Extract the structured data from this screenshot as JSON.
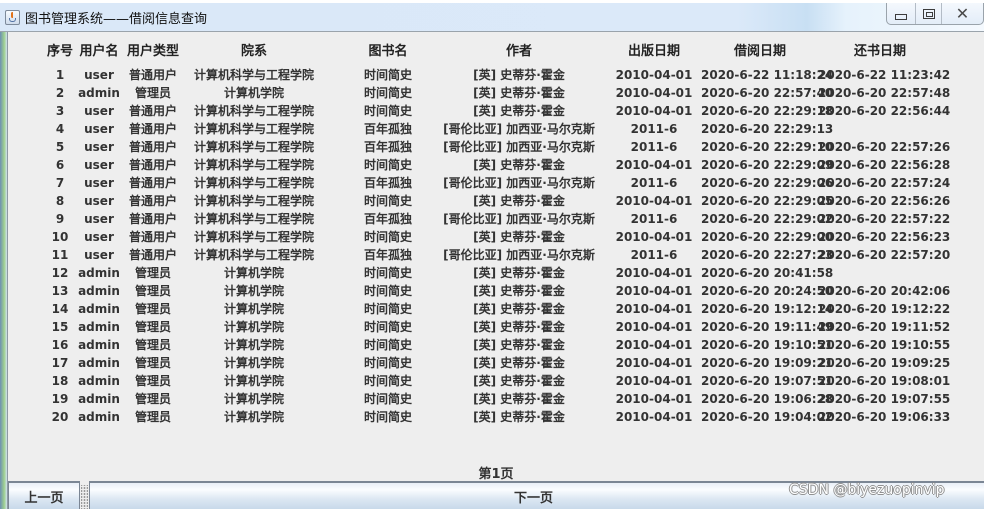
{
  "window": {
    "title": "图书管理系统——借阅信息查询",
    "icon": "java-cup-icon",
    "controls": {
      "minimize": "minimize-icon",
      "maximize": "maximize-icon",
      "close_glyph": "✕"
    }
  },
  "table": {
    "columns": [
      "序号",
      "用户名",
      "用户类型",
      "院系",
      "图书名",
      "作者",
      "出版日期",
      "借阅日期",
      "还书日期"
    ],
    "rows": [
      [
        "1",
        "user",
        "普通用户",
        "计算机科学与工程学院",
        "时间简史",
        "[英] 史蒂芬·霍金",
        "2010-04-01",
        "2020-6-22 11:18:24",
        "2020-6-22 11:23:42"
      ],
      [
        "2",
        "admin",
        "管理员",
        "计算机学院",
        "时间简史",
        "[英] 史蒂芬·霍金",
        "2010-04-01",
        "2020-6-20 22:57:40",
        "2020-6-20 22:57:48"
      ],
      [
        "3",
        "user",
        "普通用户",
        "计算机科学与工程学院",
        "时间简史",
        "[英] 史蒂芬·霍金",
        "2010-04-01",
        "2020-6-20 22:29:18",
        "2020-6-20 22:56:44"
      ],
      [
        "4",
        "user",
        "普通用户",
        "计算机科学与工程学院",
        "百年孤独",
        "[哥伦比亚] 加西亚·马尔克斯",
        "2011-6",
        "2020-6-20 22:29:13",
        ""
      ],
      [
        "5",
        "user",
        "普通用户",
        "计算机科学与工程学院",
        "百年孤独",
        "[哥伦比亚] 加西亚·马尔克斯",
        "2011-6",
        "2020-6-20 22:29:10",
        "2020-6-20 22:57:26"
      ],
      [
        "6",
        "user",
        "普通用户",
        "计算机科学与工程学院",
        "时间简史",
        "[英] 史蒂芬·霍金",
        "2010-04-01",
        "2020-6-20 22:29:09",
        "2020-6-20 22:56:28"
      ],
      [
        "7",
        "user",
        "普通用户",
        "计算机科学与工程学院",
        "百年孤独",
        "[哥伦比亚] 加西亚·马尔克斯",
        "2011-6",
        "2020-6-20 22:29:06",
        "2020-6-20 22:57:24"
      ],
      [
        "8",
        "user",
        "普通用户",
        "计算机科学与工程学院",
        "时间简史",
        "[英] 史蒂芬·霍金",
        "2010-04-01",
        "2020-6-20 22:29:05",
        "2020-6-20 22:56:26"
      ],
      [
        "9",
        "user",
        "普通用户",
        "计算机科学与工程学院",
        "百年孤独",
        "[哥伦比亚] 加西亚·马尔克斯",
        "2011-6",
        "2020-6-20 22:29:02",
        "2020-6-20 22:57:22"
      ],
      [
        "10",
        "user",
        "普通用户",
        "计算机科学与工程学院",
        "时间简史",
        "[英] 史蒂芬·霍金",
        "2010-04-01",
        "2020-6-20 22:29:00",
        "2020-6-20 22:56:23"
      ],
      [
        "11",
        "user",
        "普通用户",
        "计算机科学与工程学院",
        "百年孤独",
        "[哥伦比亚] 加西亚·马尔克斯",
        "2011-6",
        "2020-6-20 22:27:23",
        "2020-6-20 22:57:20"
      ],
      [
        "12",
        "admin",
        "管理员",
        "计算机学院",
        "时间简史",
        "[英] 史蒂芬·霍金",
        "2010-04-01",
        "2020-6-20 20:41:58",
        ""
      ],
      [
        "13",
        "admin",
        "管理员",
        "计算机学院",
        "时间简史",
        "[英] 史蒂芬·霍金",
        "2010-04-01",
        "2020-6-20 20:24:50",
        "2020-6-20 20:42:06"
      ],
      [
        "14",
        "admin",
        "管理员",
        "计算机学院",
        "时间简史",
        "[英] 史蒂芬·霍金",
        "2010-04-01",
        "2020-6-20 19:12:14",
        "2020-6-20 19:12:22"
      ],
      [
        "15",
        "admin",
        "管理员",
        "计算机学院",
        "时间简史",
        "[英] 史蒂芬·霍金",
        "2010-04-01",
        "2020-6-20 19:11:49",
        "2020-6-20 19:11:52"
      ],
      [
        "16",
        "admin",
        "管理员",
        "计算机学院",
        "时间简史",
        "[英] 史蒂芬·霍金",
        "2010-04-01",
        "2020-6-20 19:10:51",
        "2020-6-20 19:10:55"
      ],
      [
        "17",
        "admin",
        "管理员",
        "计算机学院",
        "时间简史",
        "[英] 史蒂芬·霍金",
        "2010-04-01",
        "2020-6-20 19:09:21",
        "2020-6-20 19:09:25"
      ],
      [
        "18",
        "admin",
        "管理员",
        "计算机学院",
        "时间简史",
        "[英] 史蒂芬·霍金",
        "2010-04-01",
        "2020-6-20 19:07:51",
        "2020-6-20 19:08:01"
      ],
      [
        "19",
        "admin",
        "管理员",
        "计算机学院",
        "时间简史",
        "[英] 史蒂芬·霍金",
        "2010-04-01",
        "2020-6-20 19:06:28",
        "2020-6-20 19:07:55"
      ],
      [
        "20",
        "admin",
        "管理员",
        "计算机学院",
        "时间简史",
        "[英] 史蒂芬·霍金",
        "2010-04-01",
        "2020-6-20 19:04:02",
        "2020-6-20 19:06:33"
      ]
    ]
  },
  "pagination": {
    "page_label": "第1页",
    "prev_label": "上一页",
    "next_label": "下一页"
  },
  "watermark": "CSDN @biyezuopinvip"
}
